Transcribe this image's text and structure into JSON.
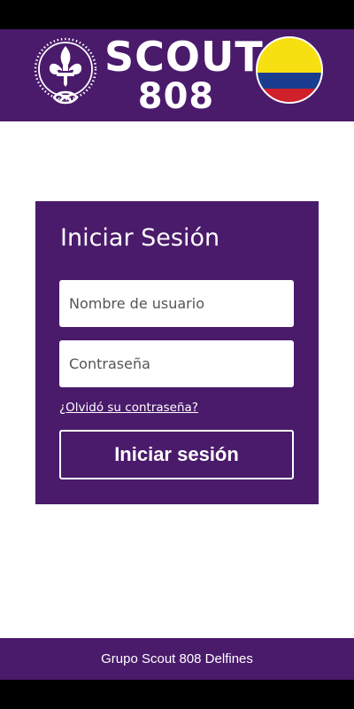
{
  "header": {
    "brand_line1": "SCOUT",
    "brand_line2": "808",
    "emblem_icon": "scout-fleur-de-lis-emblem-icon",
    "flag_icon": "colombia-flag-icon"
  },
  "login": {
    "title": "Iniciar Sesión",
    "username_placeholder": "Nombre de usuario",
    "username_value": "",
    "password_placeholder": "Contraseña",
    "password_value": "",
    "forgot_password_label": "¿Olvidó su contraseña?",
    "submit_label": "Iniciar sesión"
  },
  "footer": {
    "text": "Grupo Scout 808 Delfines"
  },
  "colors": {
    "brand_purple": "#4a1a6b",
    "flag_yellow": "#f7e012",
    "flag_blue": "#1a3d8f",
    "flag_red": "#d0202a"
  }
}
